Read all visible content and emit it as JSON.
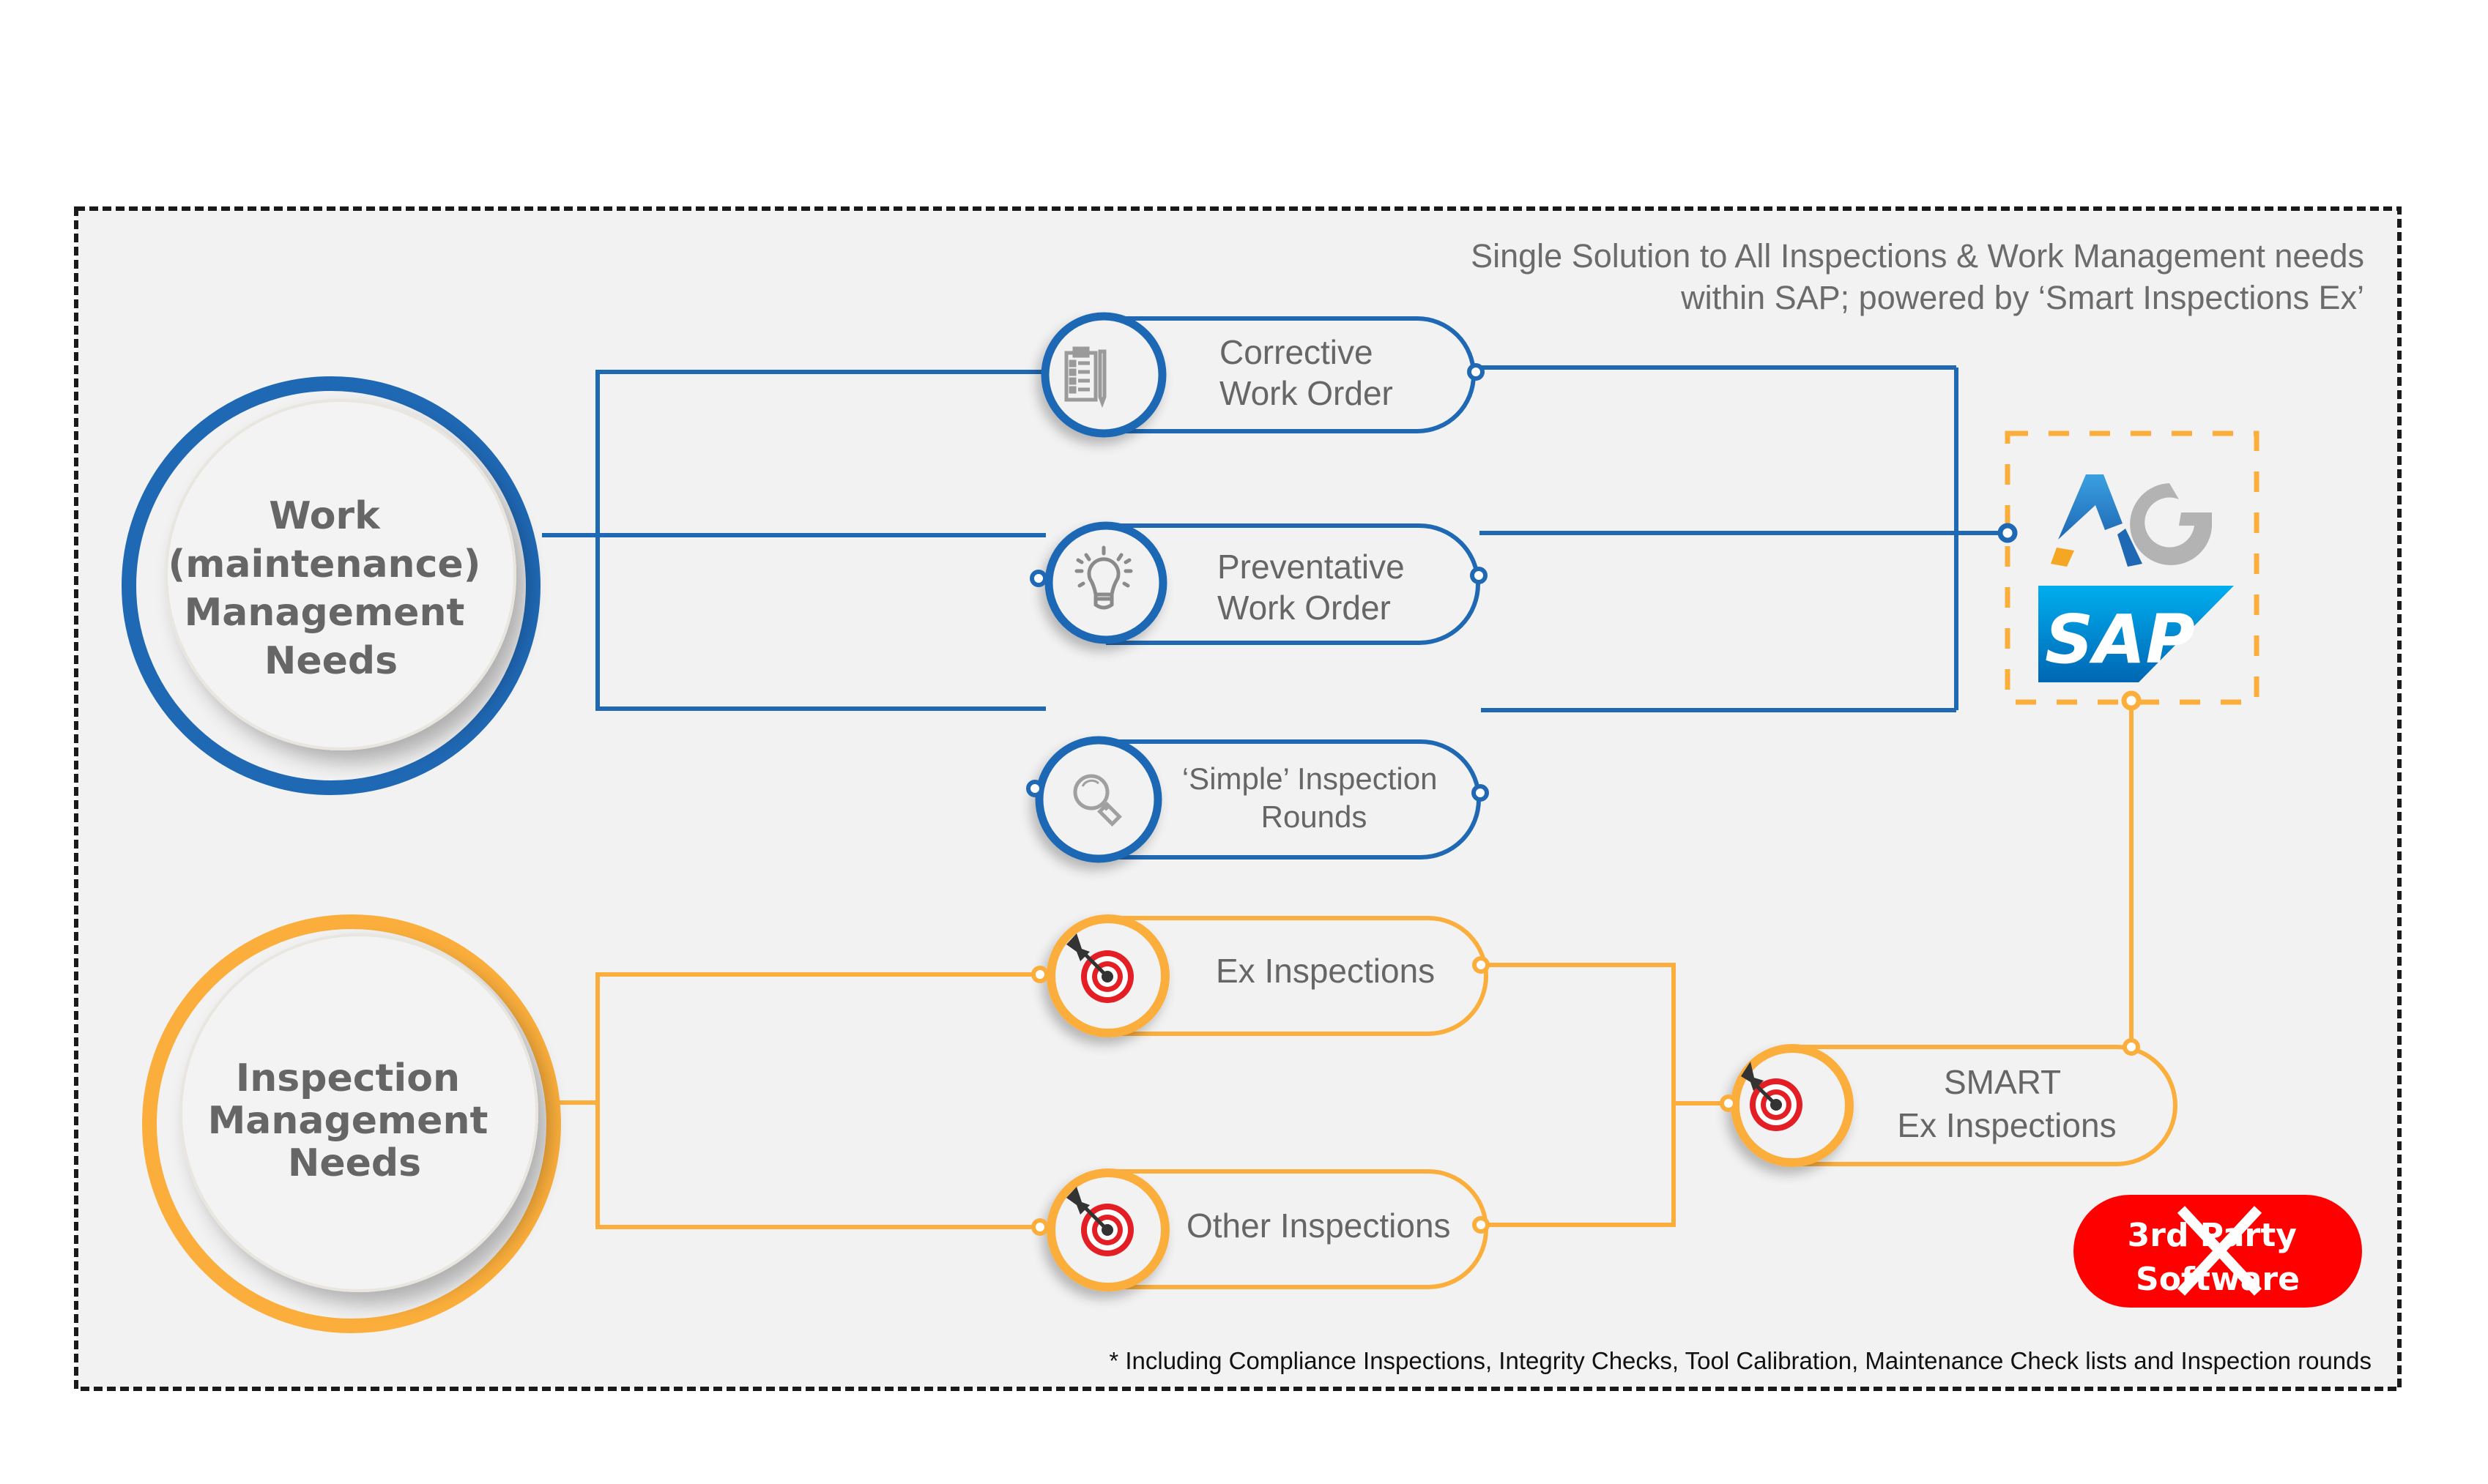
{
  "header": {
    "line1": "Single Solution to All Inspections & Work Management needs",
    "line2": "within SAP; powered by ‘Smart Inspections Ex’"
  },
  "colors": {
    "blue": "#1f68b4",
    "orange": "#fbae3b",
    "background": "#f2f2f2",
    "text_gray": "#666666",
    "badge_red": "#ff0000"
  },
  "hubs": [
    {
      "id": "work",
      "lines": [
        "Work",
        "(maintenance)",
        "Management",
        "Needs"
      ]
    },
    {
      "id": "inspection",
      "lines": [
        "Inspection",
        "Management",
        "Needs"
      ]
    }
  ],
  "work_items": [
    {
      "icon": "clipboard-icon",
      "lines": [
        "Corrective",
        "Work Order"
      ]
    },
    {
      "icon": "lightbulb-icon",
      "lines": [
        "Preventative",
        "Work Order"
      ]
    },
    {
      "icon": "magnifier-icon",
      "lines": [
        "‘Simple’ Inspection",
        "Rounds"
      ]
    }
  ],
  "inspection_items": [
    {
      "icon": "target-icon",
      "lines": [
        "Ex Inspections"
      ]
    },
    {
      "icon": "target-icon",
      "lines": [
        "Other Inspections"
      ]
    }
  ],
  "smart_node": {
    "icon": "target-icon",
    "lines": [
      "SMART",
      "Ex Inspections"
    ]
  },
  "logos": {
    "ag": "AG",
    "sap": "SAP"
  },
  "badge": {
    "lines": [
      "3rd Party",
      "Software"
    ],
    "crossed_out": true
  },
  "footnote": "* Including Compliance Inspections, Integrity Checks,  Tool Calibration, Maintenance Check lists and Inspection rounds"
}
